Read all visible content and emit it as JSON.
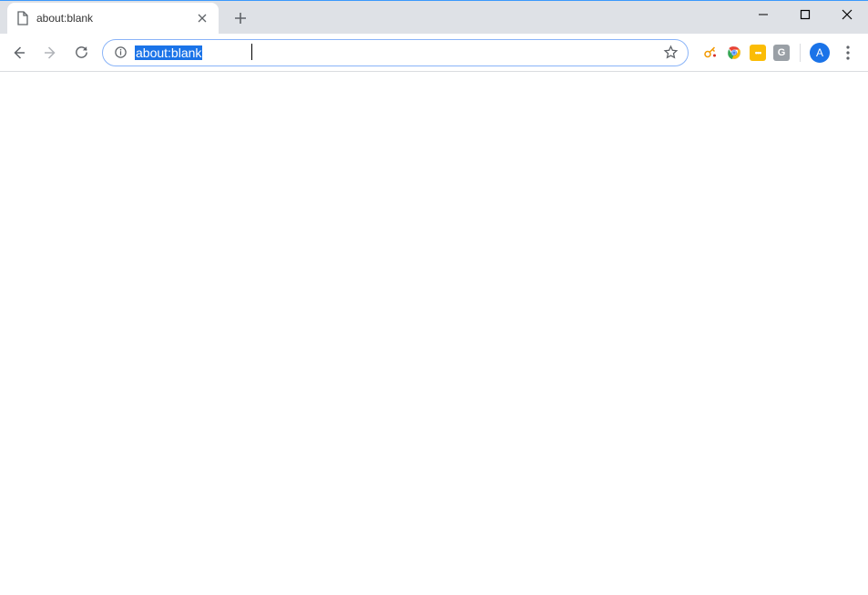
{
  "tab": {
    "title": "about:blank"
  },
  "omnibox": {
    "url": "about:blank"
  },
  "avatar": {
    "initial": "A"
  },
  "extension_badge": {
    "text": "•••"
  }
}
